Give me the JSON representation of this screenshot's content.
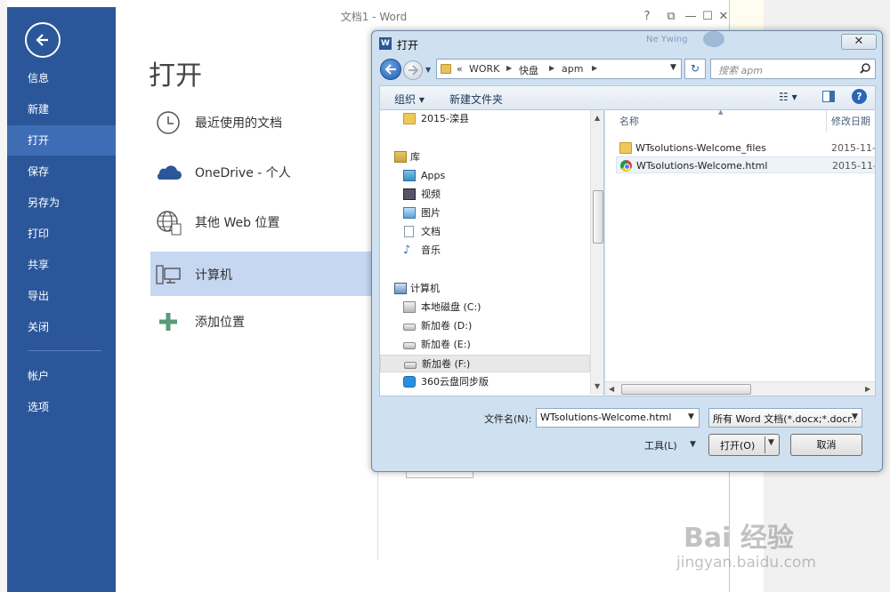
{
  "word": {
    "title": "文档1 - Word",
    "controls": {
      "help": "?",
      "restore": "⧉",
      "minimize": "—",
      "maximize": "☐",
      "close": "✕"
    },
    "heading": "打开",
    "nav": [
      "信息",
      "新建",
      "打开",
      "保存",
      "另存为",
      "打印",
      "共享",
      "导出",
      "关闭",
      "帐户",
      "选项"
    ],
    "nav_active": "打开",
    "places": [
      {
        "label": "最近使用的文档",
        "icon": "clock-icon"
      },
      {
        "label": "OneDrive - 个人",
        "icon": "cloud-icon"
      },
      {
        "label": "其他 Web 位置",
        "icon": "globe-icon"
      },
      {
        "label": "计算机",
        "icon": "computer-icon"
      },
      {
        "label": "添加位置",
        "icon": "plus-icon"
      }
    ],
    "accent": "#2b579a"
  },
  "dialog": {
    "title": "打开",
    "close": "✕",
    "ghost_text": "Ne Ywing",
    "address": {
      "crumbs": [
        "WORK",
        "快盘",
        "apm"
      ],
      "prefix": "«"
    },
    "search_placeholder": "搜索 apm",
    "toolbar": {
      "organize": "组织 ▾",
      "new_folder": "新建文件夹",
      "views": "☷ ▾"
    },
    "tree": [
      "2015-滦县",
      "库",
      "Apps",
      "视频",
      "图片",
      "文档",
      "音乐",
      "计算机",
      "本地磁盘 (C:)",
      "新加卷 (D:)",
      "新加卷 (E:)",
      "新加卷 (F:)",
      "360云盘同步版"
    ],
    "columns": {
      "name": "名称",
      "date": "修改日期"
    },
    "files": [
      {
        "name": "WTsolutions-Welcome_files",
        "date": "2015-11-",
        "icon": "folder-icon"
      },
      {
        "name": "WTsolutions-Welcome.html",
        "date": "2015-11-",
        "icon": "chrome-icon"
      }
    ],
    "filename_label": "文件名(N):",
    "filename_value": "WTsolutions-Welcome.html",
    "filter_value": "所有 Word 文档(*.docx;*.docm",
    "tools_label": "工具(L)",
    "open_label": "打开(O)",
    "cancel_label": "取消"
  },
  "watermark": {
    "main": "Bai 经验",
    "sub": "jingyan.baidu.com"
  }
}
